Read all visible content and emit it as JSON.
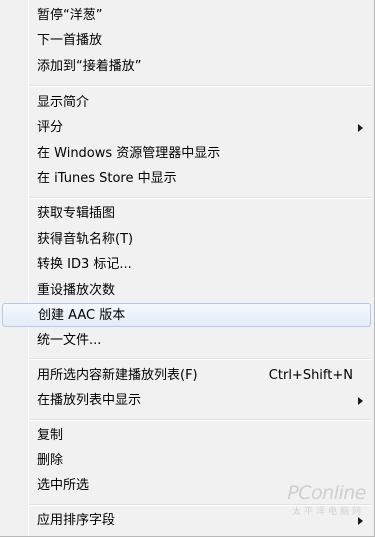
{
  "menu": {
    "items": [
      {
        "label": "暂停“洋葱”"
      },
      {
        "label": "下一首播放"
      },
      {
        "label": "添加到“接着播放”"
      },
      {
        "label": "显示简介"
      },
      {
        "label": "评分"
      },
      {
        "label": "在 Windows 资源管理器中显示"
      },
      {
        "label": "在 iTunes Store 中显示"
      },
      {
        "label": "获取专辑插图"
      },
      {
        "label": "获得音轨名称(T)"
      },
      {
        "label": "转换 ID3 标记..."
      },
      {
        "label": "重设播放次数"
      },
      {
        "label": "创建 AAC 版本"
      },
      {
        "label": "统一文件..."
      },
      {
        "label": "用所选内容新建播放列表(F)",
        "shortcut": "Ctrl+Shift+N"
      },
      {
        "label": "在播放列表中显示"
      },
      {
        "label": "复制"
      },
      {
        "label": "删除"
      },
      {
        "label": "选中所选"
      },
      {
        "label": "应用排序字段"
      }
    ]
  },
  "watermark": {
    "logo": "PConline",
    "sub": "太平洋电脑网"
  }
}
